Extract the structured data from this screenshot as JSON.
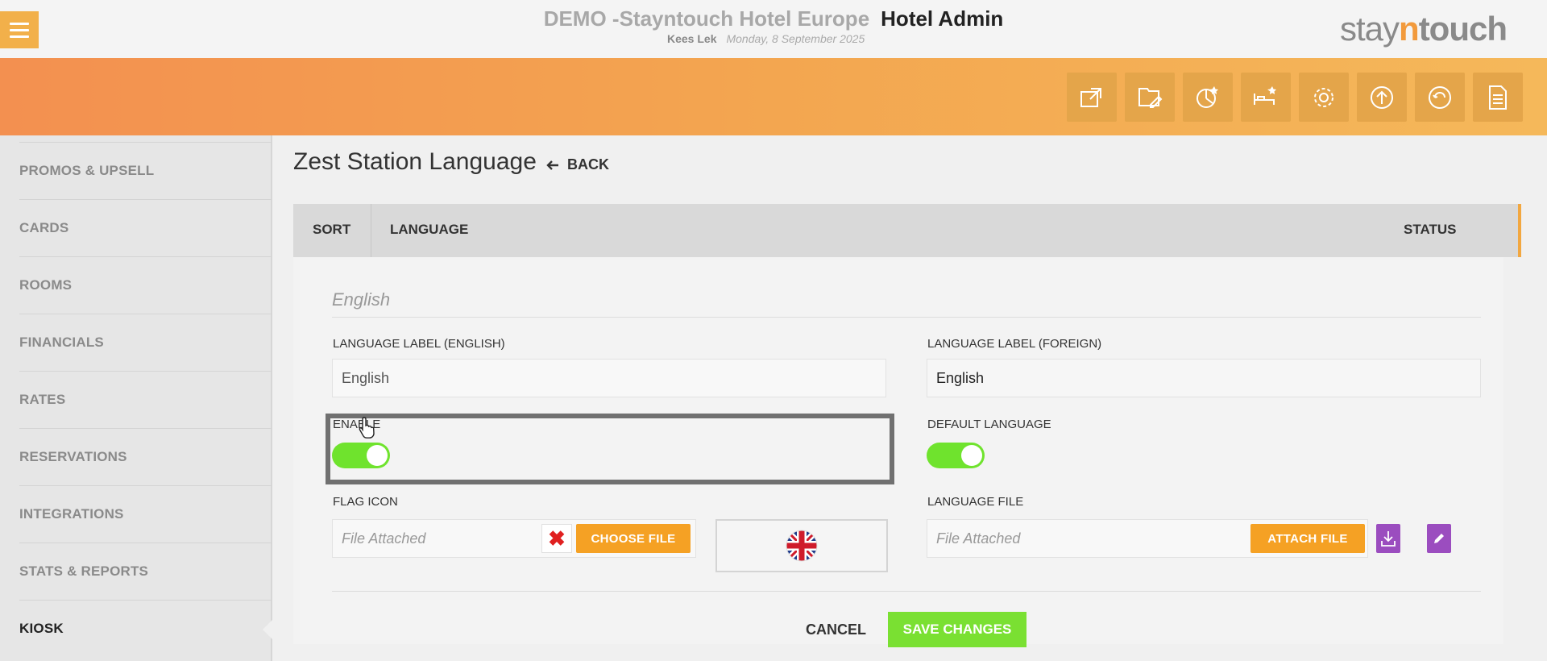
{
  "header": {
    "hotel_name": "DEMO -Stayntouch Hotel Europe",
    "app_name": "Hotel Admin",
    "user": "Kees Lek",
    "date": "Monday, 8 September 2025",
    "logo": {
      "part1": "stay",
      "part2": "n",
      "part3": "touch"
    }
  },
  "toolbar": {
    "icons": [
      "external-link-icon",
      "edit-folder-icon",
      "chart-star-icon",
      "bed-star-icon",
      "gear-icon",
      "upload-icon",
      "back-arrow-icon",
      "document-icon"
    ]
  },
  "sidebar": {
    "items": [
      {
        "label": "PROMOS & UPSELL"
      },
      {
        "label": "CARDS"
      },
      {
        "label": "ROOMS"
      },
      {
        "label": "FINANCIALS"
      },
      {
        "label": "RATES"
      },
      {
        "label": "RESERVATIONS"
      },
      {
        "label": "INTEGRATIONS"
      },
      {
        "label": "STATS & REPORTS"
      },
      {
        "label": "KIOSK"
      }
    ]
  },
  "main": {
    "title": "Zest Station Language",
    "back_label": "BACK",
    "table": {
      "col_sort": "SORT",
      "col_language": "LANGUAGE",
      "col_status": "STATUS"
    },
    "form": {
      "language_name": "English",
      "label_english_title": "LANGUAGE LABEL (ENGLISH)",
      "label_english_value": "English",
      "label_foreign_title": "LANGUAGE LABEL (FOREIGN)",
      "label_foreign_value": "English",
      "enable_title": "ENABLE",
      "enable_on": true,
      "default_title": "DEFAULT LANGUAGE",
      "default_on": true,
      "flag_title": "FLAG ICON",
      "flag_file_text": "File Attached",
      "choose_file_label": "CHOOSE FILE",
      "language_file_title": "LANGUAGE FILE",
      "language_file_text": "File Attached",
      "attach_file_label": "ATTACH FILE",
      "cancel_label": "CANCEL",
      "save_label": "SAVE CHANGES"
    }
  },
  "colors": {
    "accent_orange": "#f5a124",
    "toggle_green": "#6fe32d",
    "save_green": "#7ae032",
    "purple": "#9b4dbf"
  }
}
